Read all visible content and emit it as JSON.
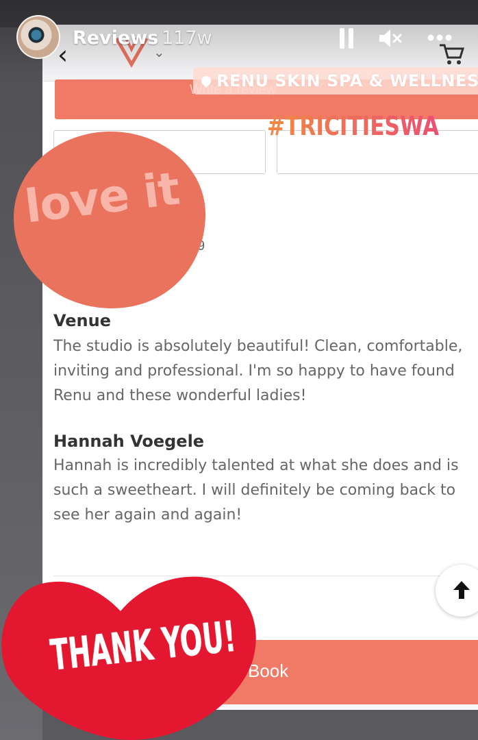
{
  "story": {
    "title": "Reviews",
    "age": "117w",
    "controls": {
      "pause_icon": "pause-icon",
      "mute_icon": "speaker-muted-icon",
      "more_icon": "ellipsis-icon"
    }
  },
  "browser": {
    "back_icon": "chevron-left-icon",
    "cart_icon": "cart-icon"
  },
  "page": {
    "write_review_label": "Write a review",
    "date_fragment": "9",
    "sections": [
      {
        "title": "Venue",
        "body": "The studio is absolutely beautiful! Clean, comfortable,\ninviting and professional. I'm so happy to have found\nRenu and these wonderful ladies!"
      },
      {
        "title": "Hannah Voegele",
        "body": "Hannah is incredibly talented at what she does and is\nsuch a sweetheart. I will definitely be coming back to\nsee her again and again!"
      }
    ],
    "book_label": "Book"
  },
  "stickers": {
    "location": "RENU SKIN SPA & WELLNESS",
    "hashtag": "#TRICITIESWA",
    "love": "love it",
    "thank_you": "THANK YOU!"
  },
  "colors": {
    "accent": "#f07a66",
    "heart": "#e3172f",
    "love_circle": "#e9735c"
  }
}
